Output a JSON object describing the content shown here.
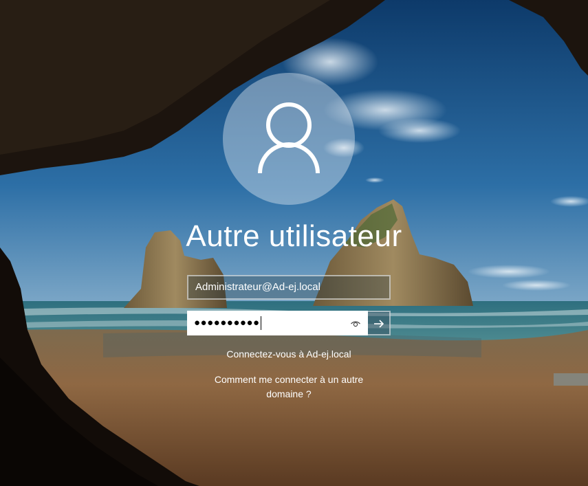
{
  "login": {
    "user_name": "Autre utilisateur",
    "username_value": "Administrateur@Ad-ej.local",
    "password_mask": "●●●●●●●●●●",
    "signin_to": "Connectez-vous à Ad-ej.local",
    "other_domain_line1": "Comment me connecter à un autre",
    "other_domain_line2": "domaine ?"
  },
  "icons": {
    "avatar": "user-silhouette-icon",
    "reveal": "eye-icon",
    "submit": "arrow-right-icon"
  },
  "colors": {
    "sky": "#1c5a8c",
    "sea": "#2f6f7a",
    "sand": "#8a6641",
    "cave": "#1a120c",
    "text": "#ffffff",
    "field_border": "#ffffff"
  }
}
